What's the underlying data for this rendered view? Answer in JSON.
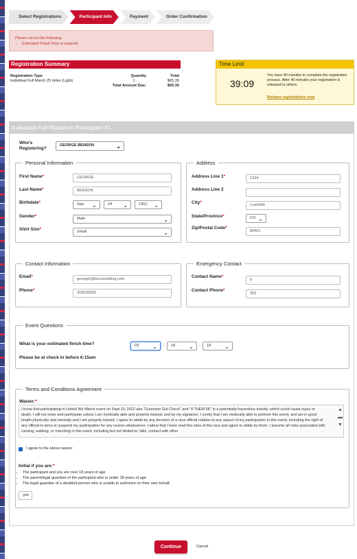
{
  "steps": [
    "Select Registrations",
    "Participant Info",
    "Payment",
    "Order Confirmation"
  ],
  "error": {
    "title": "Please correct the following:",
    "items": [
      "Estimated Finish Time is required."
    ]
  },
  "registration_summary": {
    "title": "Registration Summary",
    "headers": [
      "Registration Type",
      "Quantity",
      "Total"
    ],
    "row": [
      "Individual Full March 25 miles (Light)",
      "1",
      "$65.35"
    ],
    "total_label": "Total Amount Due:",
    "total_value": "$65.35"
  },
  "time_limit": {
    "title": "Time Limit",
    "timer": "39:09",
    "text": "You have 40 minutes to complete the registration process. After 40 minutes your registration is released to others.",
    "link": "Release registrations now"
  },
  "participant": {
    "header": "Individual Full Marathon Participant #1",
    "who_label": "Who's Registering?",
    "who_value": "GEORGE BENSON"
  },
  "personal": {
    "legend": "Personal Information",
    "first_name_label": "First Name",
    "first_name": "GEORGE",
    "last_name_label": "Last Name",
    "last_name": "BENSON",
    "birthdate_label": "Birthdate",
    "birth_month": "Sep",
    "birth_day": "24",
    "birth_year": "1951",
    "gender_label": "Gender",
    "gender": "Male",
    "shirt_label": "Shirt Size",
    "shirt": "Small"
  },
  "address": {
    "legend": "Address",
    "line1_label": "Address Line 1",
    "line1": "1234",
    "line2_label": "Address Line 2",
    "line2": "",
    "city_label": "City",
    "city": "Leadville",
    "state_label": "State/Province",
    "state": "CO",
    "zip_label": "Zip/Postal Code",
    "zip": "80461"
  },
  "contact": {
    "legend": "Contact Information",
    "email_label": "Email",
    "email": "georgeb@bcconsulting.com",
    "phone_label": "Phone",
    "phone": "303030303"
  },
  "emergency": {
    "legend": "Emergency Contact",
    "name_label": "Contact Name",
    "name": "b",
    "phone_label": "Contact Phone",
    "phone": "303"
  },
  "event": {
    "legend": "Event Questions",
    "finish_label": "What is your estimated finish time?",
    "hh": "03",
    "mm": "18",
    "ss": "18",
    "checkin": "Please be at check in before 6:15am"
  },
  "terms": {
    "legend": "Terms and Conditions Agreement",
    "waiver_label": "Waiver:",
    "waiver_text": "I know that participating in United We March event on Sept 10, 2022 aka \"Gunnison Gut Check\" and \"4 THEM 5K\" is a potentially hazardous activity, which could cause injury or death. I will not enter and participate unless I am medically able and properly trained, and by my signature, I certify that I am medically able to perform this event, and am in good health physically and mentally and I am properly trained. I agree to abide by any decision of a race official relative to any aspect of my participation in this event, including the right of any official to deny or suspend my participation for any reason whatsoever. I attest that I have read the rules of the race and agree to abide by them. I assume all risks associated with running, walking, or marching in this event, including but not limited to: falls, contact with other",
    "agree": "I agree to the above waiver",
    "initial_label": "Initial if you are:",
    "bullets": [
      "The participant and you are over 18 years of age",
      "The parent/legal guardian of the participant who is under 18 years of age",
      "The legal guardian of a disabled person who is unable to authorize on their own behalf."
    ],
    "initials": "gab"
  },
  "actions": {
    "continue": "Continue",
    "cancel": "Cancel"
  },
  "colors": {
    "accent": "#c8102e",
    "timebar": "#f2c400"
  }
}
